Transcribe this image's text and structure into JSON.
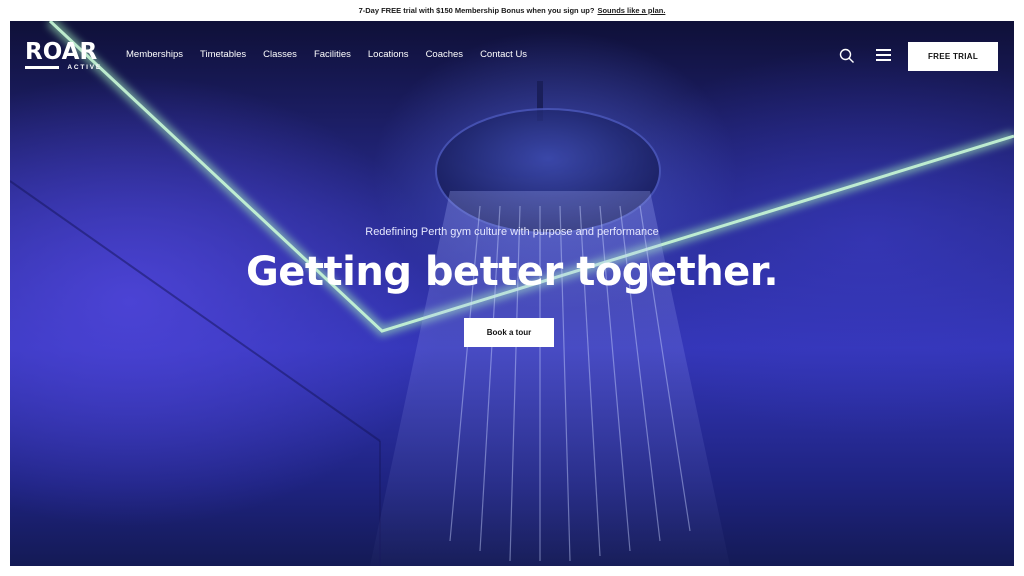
{
  "announcement": {
    "text": "7-Day FREE trial with $150 Membership Bonus when you sign up?",
    "link": "Sounds like a plan."
  },
  "brand": {
    "name": "ROAR",
    "sub": "ACTIVE"
  },
  "nav": {
    "items": [
      "Memberships",
      "Timetables",
      "Classes",
      "Facilities",
      "Locations",
      "Coaches",
      "Contact Us"
    ],
    "cta": "FREE TRIAL"
  },
  "hero": {
    "tagline": "Redefining Perth gym culture with purpose and performance",
    "headline": "Getting better together.",
    "button": "Book a tour"
  },
  "colors": {
    "accent_glow": "#9fe8b8",
    "hero_blue": "#3436b8",
    "hero_dark": "#0f1038"
  },
  "icons": [
    "search-icon",
    "menu-icon"
  ]
}
